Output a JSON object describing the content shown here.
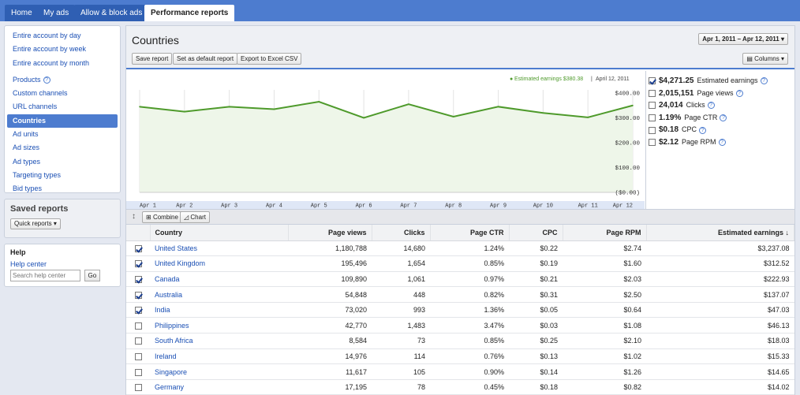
{
  "nav_tabs": [
    "Home",
    "My ads",
    "Allow & block ads",
    "Performance reports"
  ],
  "sidebar": {
    "items": [
      "Entire account by day",
      "Entire account by week",
      "Entire account by month",
      "Products",
      "Custom channels",
      "URL channels",
      "Countries",
      "Ad units",
      "Ad sizes",
      "Ad types",
      "Targeting types",
      "Bid types"
    ],
    "active_item": "Countries"
  },
  "saved_reports": {
    "title": "Saved reports",
    "button": "Quick reports"
  },
  "help": {
    "title": "Help",
    "link": "Help center",
    "search_placeholder": "Search help center",
    "go": "Go"
  },
  "page": {
    "title": "Countries",
    "date_range": "Apr 1, 2011 – Apr 12, 2011",
    "buttons": [
      "Save report",
      "Set as default report",
      "Export to Excel CSV"
    ],
    "columns_button": "Columns"
  },
  "chart_legend": "Estimated earnings $380.38",
  "chart_legend_date": "April 12, 2011",
  "chart_data": {
    "type": "area",
    "x": [
      "Apr 1",
      "Apr 2",
      "Apr 3",
      "Apr 4",
      "Apr 5",
      "Apr 6",
      "Apr 7",
      "Apr 8",
      "Apr 9",
      "Apr 10",
      "Apr 11",
      "Apr 12"
    ],
    "series": [
      {
        "name": "Estimated earnings",
        "values": [
          345,
          325,
          345,
          335,
          365,
          300,
          355,
          305,
          345,
          320,
          302,
          350
        ]
      }
    ],
    "ylim": [
      0,
      400
    ],
    "y_ticks": [
      "($0.00)",
      "$100.00",
      "$200.00",
      "$300.00",
      "$400.00"
    ],
    "x_ticks": [
      "Apr 1",
      "Apr 2",
      "Apr 3",
      "Apr 4",
      "Apr 5",
      "Apr 6",
      "Apr 7",
      "Apr 8",
      "Apr 9",
      "Apr 10",
      "Apr 11",
      "Apr 12"
    ],
    "color": "#4e9a2b",
    "fill": "#eef6e9"
  },
  "metrics": [
    {
      "value": "$4,271.25",
      "label": "Estimated earnings",
      "checked": true
    },
    {
      "value": "2,015,151",
      "label": "Page views",
      "checked": false
    },
    {
      "value": "24,014",
      "label": "Clicks",
      "checked": false
    },
    {
      "value": "1.19%",
      "label": "Page CTR",
      "checked": false
    },
    {
      "value": "$0.18",
      "label": "CPC",
      "checked": false
    },
    {
      "value": "$2.12",
      "label": "Page RPM",
      "checked": false
    }
  ],
  "chart_toolbar": {
    "combine": "Combine",
    "chart": "Chart"
  },
  "table": {
    "headers": [
      "Country",
      "Page views",
      "Clicks",
      "Page CTR",
      "CPC",
      "Page RPM",
      "Estimated earnings ↓"
    ],
    "rows": [
      {
        "checked": true,
        "country": "United States",
        "page_views": "1,180,788",
        "clicks": "14,680",
        "ctr": "1.24%",
        "cpc": "$0.22",
        "rpm": "$2.74",
        "earnings": "$3,237.08"
      },
      {
        "checked": true,
        "country": "United Kingdom",
        "page_views": "195,496",
        "clicks": "1,654",
        "ctr": "0.85%",
        "cpc": "$0.19",
        "rpm": "$1.60",
        "earnings": "$312.52"
      },
      {
        "checked": true,
        "country": "Canada",
        "page_views": "109,890",
        "clicks": "1,061",
        "ctr": "0.97%",
        "cpc": "$0.21",
        "rpm": "$2.03",
        "earnings": "$222.93"
      },
      {
        "checked": true,
        "country": "Australia",
        "page_views": "54,848",
        "clicks": "448",
        "ctr": "0.82%",
        "cpc": "$0.31",
        "rpm": "$2.50",
        "earnings": "$137.07"
      },
      {
        "checked": true,
        "country": "India",
        "page_views": "73,020",
        "clicks": "993",
        "ctr": "1.36%",
        "cpc": "$0.05",
        "rpm": "$0.64",
        "earnings": "$47.03"
      },
      {
        "checked": false,
        "country": "Philippines",
        "page_views": "42,770",
        "clicks": "1,483",
        "ctr": "3.47%",
        "cpc": "$0.03",
        "rpm": "$1.08",
        "earnings": "$46.13"
      },
      {
        "checked": false,
        "country": "South Africa",
        "page_views": "8,584",
        "clicks": "73",
        "ctr": "0.85%",
        "cpc": "$0.25",
        "rpm": "$2.10",
        "earnings": "$18.03"
      },
      {
        "checked": false,
        "country": "Ireland",
        "page_views": "14,976",
        "clicks": "114",
        "ctr": "0.76%",
        "cpc": "$0.13",
        "rpm": "$1.02",
        "earnings": "$15.33"
      },
      {
        "checked": false,
        "country": "Singapore",
        "page_views": "11,617",
        "clicks": "105",
        "ctr": "0.90%",
        "cpc": "$0.14",
        "rpm": "$1.26",
        "earnings": "$14.65"
      },
      {
        "checked": false,
        "country": "Germany",
        "page_views": "17,195",
        "clicks": "78",
        "ctr": "0.45%",
        "cpc": "$0.18",
        "rpm": "$0.82",
        "earnings": "$14.02"
      }
    ]
  }
}
